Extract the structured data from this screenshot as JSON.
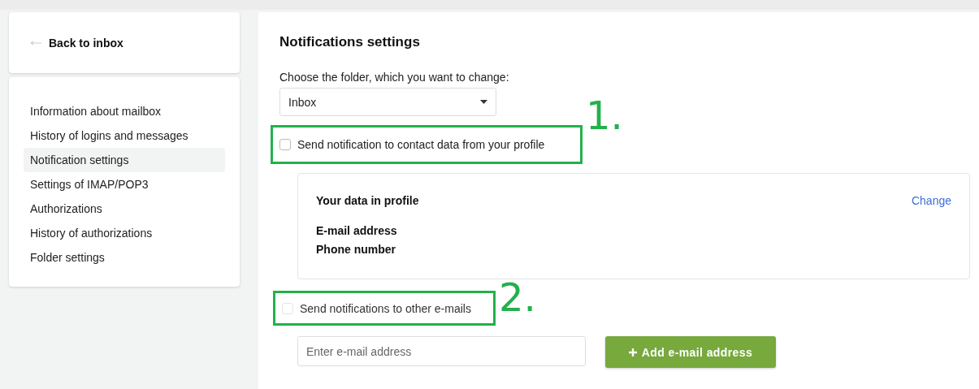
{
  "back_link": {
    "label": "Back to inbox"
  },
  "sidebar": {
    "items": [
      {
        "label": "Information about mailbox",
        "selected": false
      },
      {
        "label": "History of logins and messages",
        "selected": false
      },
      {
        "label": "Notification settings",
        "selected": true
      },
      {
        "label": "Settings of IMAP/POP3",
        "selected": false
      },
      {
        "label": "Authorizations",
        "selected": false
      },
      {
        "label": "History of authorizations",
        "selected": false
      },
      {
        "label": "Folder settings",
        "selected": false
      }
    ]
  },
  "main": {
    "title": "Notifications settings",
    "folder_label": "Choose the folder, which you want to change:",
    "folder_select": {
      "value": "Inbox"
    },
    "profile_option": {
      "label": "Send notification to contact data from your profile",
      "checked": false,
      "disabled": false,
      "annotation": "1."
    },
    "profile_card": {
      "title": "Your data in profile",
      "link": "Change",
      "fields": [
        "E-mail address",
        "Phone number"
      ]
    },
    "other_option": {
      "label": "Send notifications to other e-mails",
      "checked": false,
      "disabled": true,
      "annotation": "2."
    },
    "email_input": {
      "placeholder": "Enter e-mail address"
    },
    "add_button": {
      "label": "Add e-mail address"
    }
  }
}
